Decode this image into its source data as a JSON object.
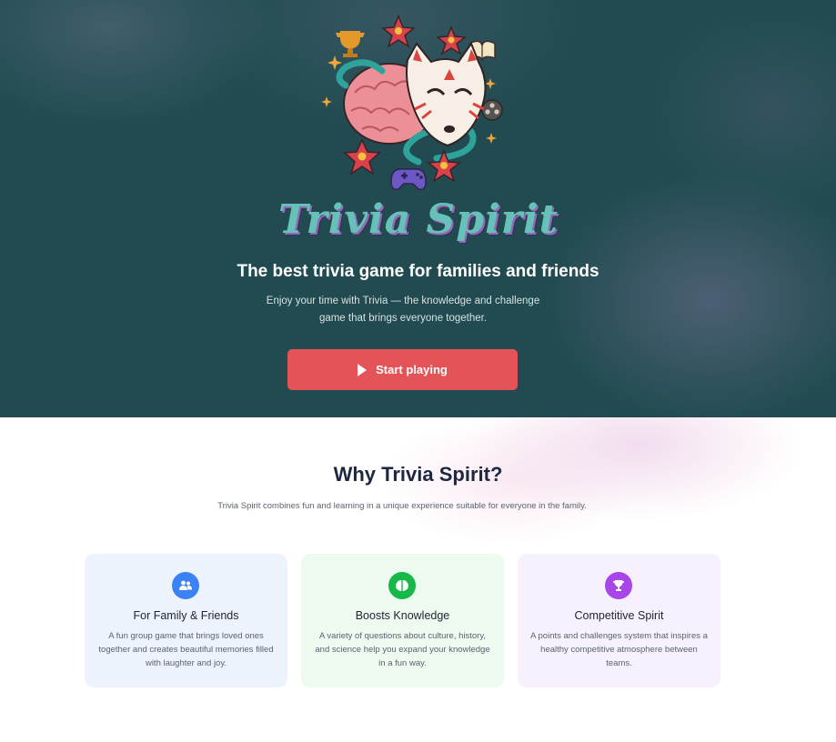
{
  "hero": {
    "logo_text": "Trivia Spirit",
    "logo_icons": [
      "trophy-icon",
      "brain-icon",
      "fox-mask-icon",
      "snake-icon",
      "flower-icon",
      "book-icon",
      "film-reel-icon",
      "gamepad-icon",
      "sparkle-icon"
    ],
    "title": "The best trivia game for families and friends",
    "subtitle": "Enjoy your time with Trivia — the knowledge and challenge game that brings everyone together.",
    "cta_label": "Start playing",
    "cta_icon": "play-icon",
    "colors": {
      "background": "#214b50",
      "cta": "#e35357"
    }
  },
  "why": {
    "title": "Why Trivia Spirit?",
    "subtitle": "Trivia Spirit combines fun and learning in a unique experience suitable for everyone in the family.",
    "cards": [
      {
        "icon": "users-icon",
        "title": "For Family & Friends",
        "text": "A fun group game that brings loved ones together and creates beautiful memories filled with laughter and joy.",
        "color": "#3b82f6"
      },
      {
        "icon": "brain-icon",
        "title": "Boosts Knowledge",
        "text": "A variety of questions about culture, history, and science help you expand your knowledge in a fun way.",
        "color": "#16b84a"
      },
      {
        "icon": "trophy-icon",
        "title": "Competitive Spirit",
        "text": "A points and challenges system that inspires a healthy competitive atmosphere between teams.",
        "color": "#a946e8"
      }
    ]
  }
}
